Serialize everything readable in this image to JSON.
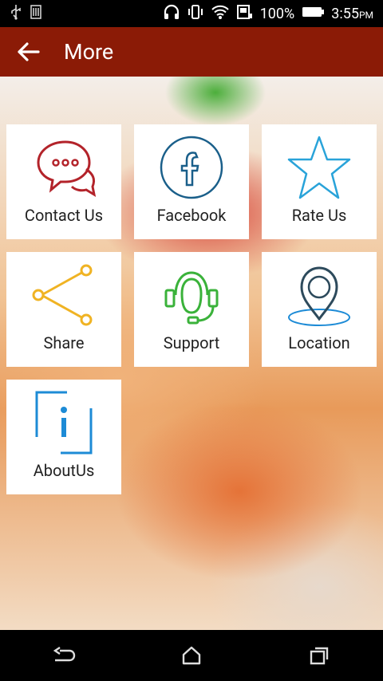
{
  "status_bar": {
    "battery_percent": "100%",
    "time": "3:55",
    "ampm": "PM"
  },
  "app_bar": {
    "title": "More"
  },
  "tiles": [
    {
      "label": "Contact Us",
      "icon": "chat-bubbles-icon",
      "color": "#b3232a"
    },
    {
      "label": "Facebook",
      "icon": "facebook-icon",
      "color": "#1a5f8a"
    },
    {
      "label": "Rate Us",
      "icon": "star-icon",
      "color": "#29a3d9"
    },
    {
      "label": "Share",
      "icon": "share-icon",
      "color": "#f0b323"
    },
    {
      "label": "Support",
      "icon": "headset-icon",
      "color": "#3ab23a"
    },
    {
      "label": "Location",
      "icon": "location-pin-icon",
      "color": "#2d4a5c"
    },
    {
      "label": "AboutUs",
      "icon": "info-icon",
      "color": "#1d8bd6"
    }
  ],
  "colors": {
    "app_bar": "#8b1b06",
    "tile_bg": "#ffffff"
  }
}
